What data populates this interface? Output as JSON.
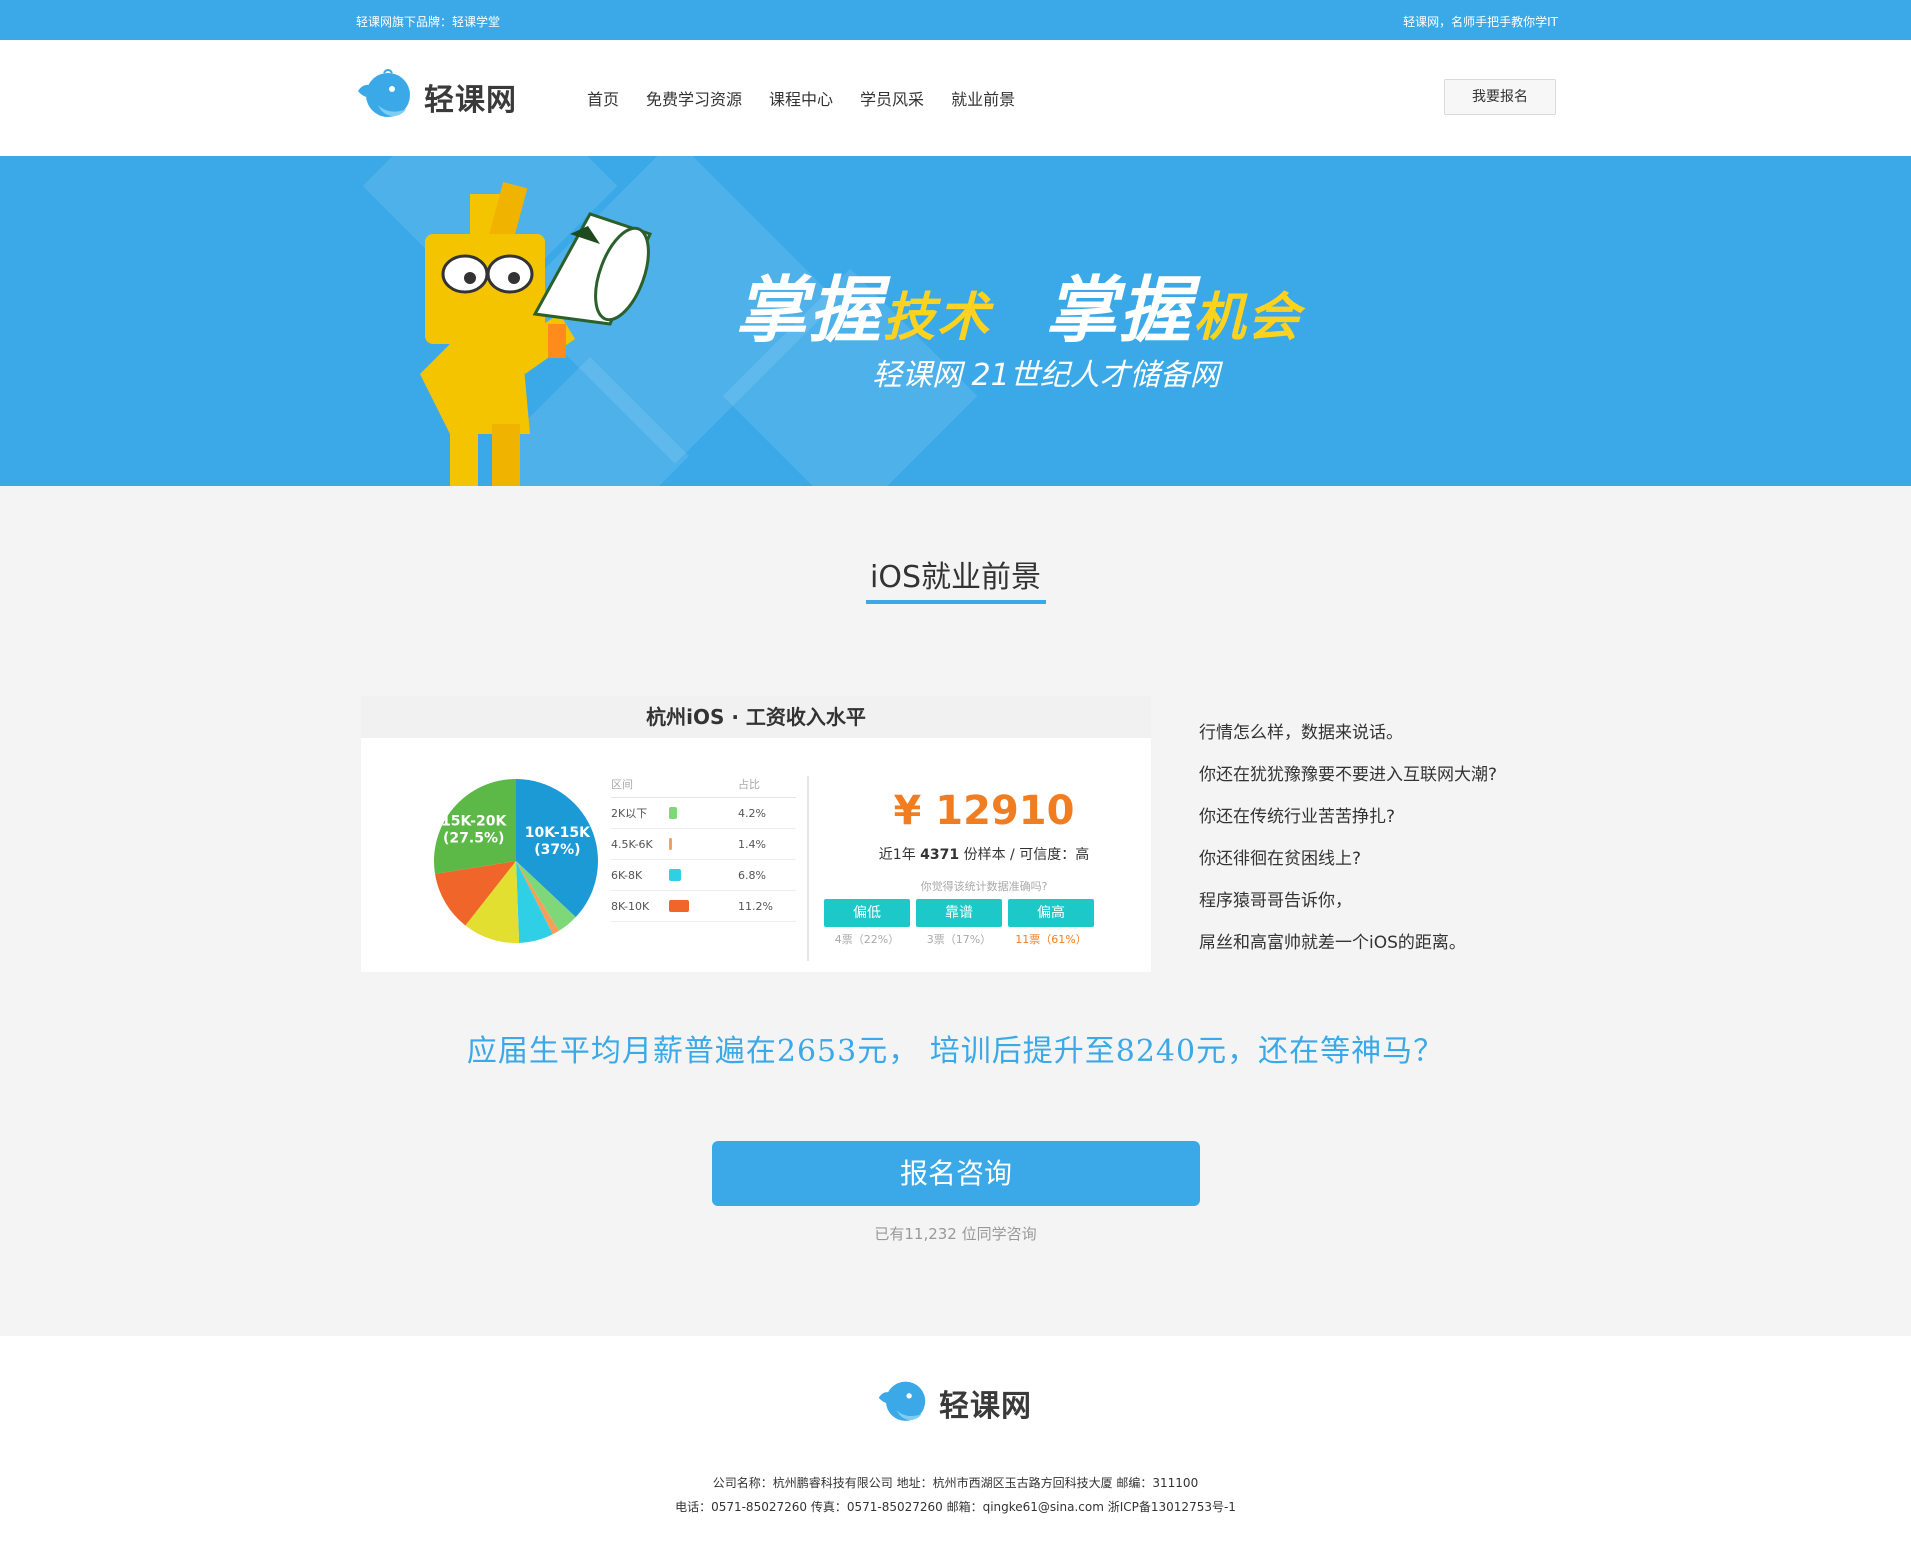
{
  "topbar": {
    "brand_line": "轻课网旗下品牌：轻课学堂",
    "slogan": "轻课网，名师手把手教你学IT"
  },
  "header": {
    "logo_text": "轻课网",
    "nav": [
      "首页",
      "免费学习资源",
      "课程中心",
      "学员风采",
      "就业前景"
    ],
    "signup_label": "我要报名"
  },
  "banner": {
    "title_part1": "掌握",
    "title_part2": "技术",
    "title_part3": "掌握",
    "title_part4": "机会",
    "subtitle": "轻课网 21世纪人才储备网"
  },
  "section": {
    "title": "iOS就业前景"
  },
  "salary_card": {
    "title": "杭州iOS · 工资收入水平",
    "legend_header": [
      "区间",
      "占比"
    ],
    "legend_rows": [
      {
        "range": "2K以下",
        "pct": "4.2%",
        "value": 4.2,
        "color": "#7ed87a"
      },
      {
        "range": "4.5K-6K",
        "pct": "1.4%",
        "value": 1.4,
        "color": "#f5a05a"
      },
      {
        "range": "6K-8K",
        "pct": "6.8%",
        "value": 6.8,
        "color": "#2fd0e6"
      },
      {
        "range": "8K-10K",
        "pct": "11.2%",
        "value": 11.2,
        "color": "#f0652a"
      }
    ],
    "pie_labels": [
      {
        "name": "10K-15K",
        "pct": "(37%)"
      },
      {
        "name": "15K-20K",
        "pct": "(27.5%)"
      }
    ],
    "salary": "¥ 12910",
    "sample_prefix": "近1年",
    "sample_count": "4371",
    "sample_suffix": "份样本 / 可信度：高",
    "ask": "你觉得该统计数据准确吗?",
    "votes": [
      {
        "label": "偏低",
        "count": "4票（22%）"
      },
      {
        "label": "靠谱",
        "count": "3票（17%）"
      },
      {
        "label": "偏高",
        "count": "11票（61%）"
      }
    ]
  },
  "chart_data": {
    "type": "pie",
    "title": "杭州iOS · 工资收入水平",
    "slices": [
      {
        "label": "10K-15K",
        "value": 37,
        "color": "#1b9ad6"
      },
      {
        "label": "2K以下",
        "value": 4.2,
        "color": "#7ed87a"
      },
      {
        "label": "4.5K-6K",
        "value": 1.4,
        "color": "#f5a05a"
      },
      {
        "label": "6K-8K",
        "value": 6.8,
        "color": "#2fd0e6"
      },
      {
        "label": "8K-10K",
        "value": 11.2,
        "color": "#e3df30"
      },
      {
        "label": "",
        "value": 11.9,
        "color": "#f0652a"
      },
      {
        "label": "15K-20K",
        "value": 27.5,
        "color": "#5cb847"
      }
    ]
  },
  "side_text": [
    "行情怎么样，数据来说话。",
    "你还在犹犹豫豫要不要进入互联网大潮?",
    "你还在传统行业苦苦挣扎?",
    "你还徘徊在贫困线上?",
    "程序猿哥哥告诉你，",
    "屌丝和高富帅就差一个iOS的距离。"
  ],
  "slogan": "应届生平均月薪普遍在2653元，  培训后提升至8240元，还在等神马？",
  "consult": {
    "button_label": "报名咨询",
    "count_text": "已有11,232 位同学咨询"
  },
  "footer": {
    "logo_text": "轻课网",
    "line1": "公司名称：杭州鹏睿科技有限公司    地址：杭州市西湖区玉古路方回科技大厦   邮编：311100",
    "line2": "电话：0571-85027260    传真：0571-85027260    邮箱：qingke61@sina.com     浙ICP备13012753号-1"
  },
  "colors": {
    "accent": "#3ba9e8",
    "orange": "#f07d22",
    "teal": "#1cc8c8"
  }
}
